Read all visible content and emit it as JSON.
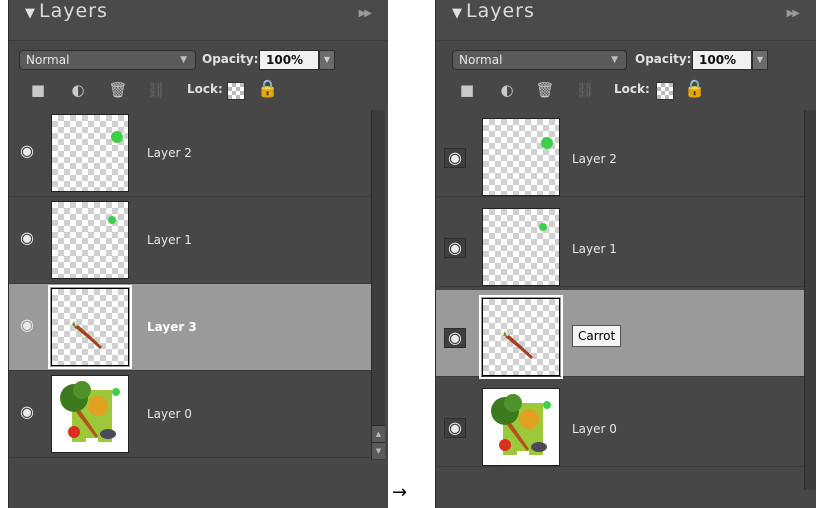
{
  "panel_title": "Layers",
  "blend_mode": "Normal",
  "opacity_label": "Opacity:",
  "opacity_value": "100%",
  "lock_label": "Lock:",
  "arrow": "→",
  "left_panel": {
    "layers": [
      {
        "name": "Layer 2",
        "thumb": "green-dot-large",
        "selected": false
      },
      {
        "name": "Layer 1",
        "thumb": "green-dot-small",
        "selected": false
      },
      {
        "name": "Layer 3",
        "thumb": "carrot",
        "selected": true
      },
      {
        "name": "Layer 0",
        "thumb": "vegetables-photo",
        "selected": false
      }
    ]
  },
  "right_panel": {
    "layers": [
      {
        "name": "Layer 2",
        "thumb": "green-dot-large",
        "selected": false
      },
      {
        "name": "Layer 1",
        "thumb": "green-dot-small",
        "selected": false
      },
      {
        "name": "Carrot",
        "thumb": "carrot",
        "selected": true,
        "editing": true
      },
      {
        "name": "Layer 0",
        "thumb": "vegetables-photo",
        "selected": false
      }
    ]
  },
  "icons": {
    "collapse": "triangle-down-icon",
    "panel_menu": "double-chevron-icon",
    "new_layer": "new-layer-icon",
    "adjustment": "adjustment-layer-icon",
    "trash": "trash-icon",
    "link": "link-icon",
    "lock_transparency": "lock-transparency-icon",
    "lock_all": "padlock-icon",
    "visibility": "eye-icon"
  },
  "colors": {
    "panel_bg": "#474747",
    "selected_row": "#9a9a9a",
    "green_dot": "#3ecf4a",
    "carrot": "#a3431f"
  }
}
